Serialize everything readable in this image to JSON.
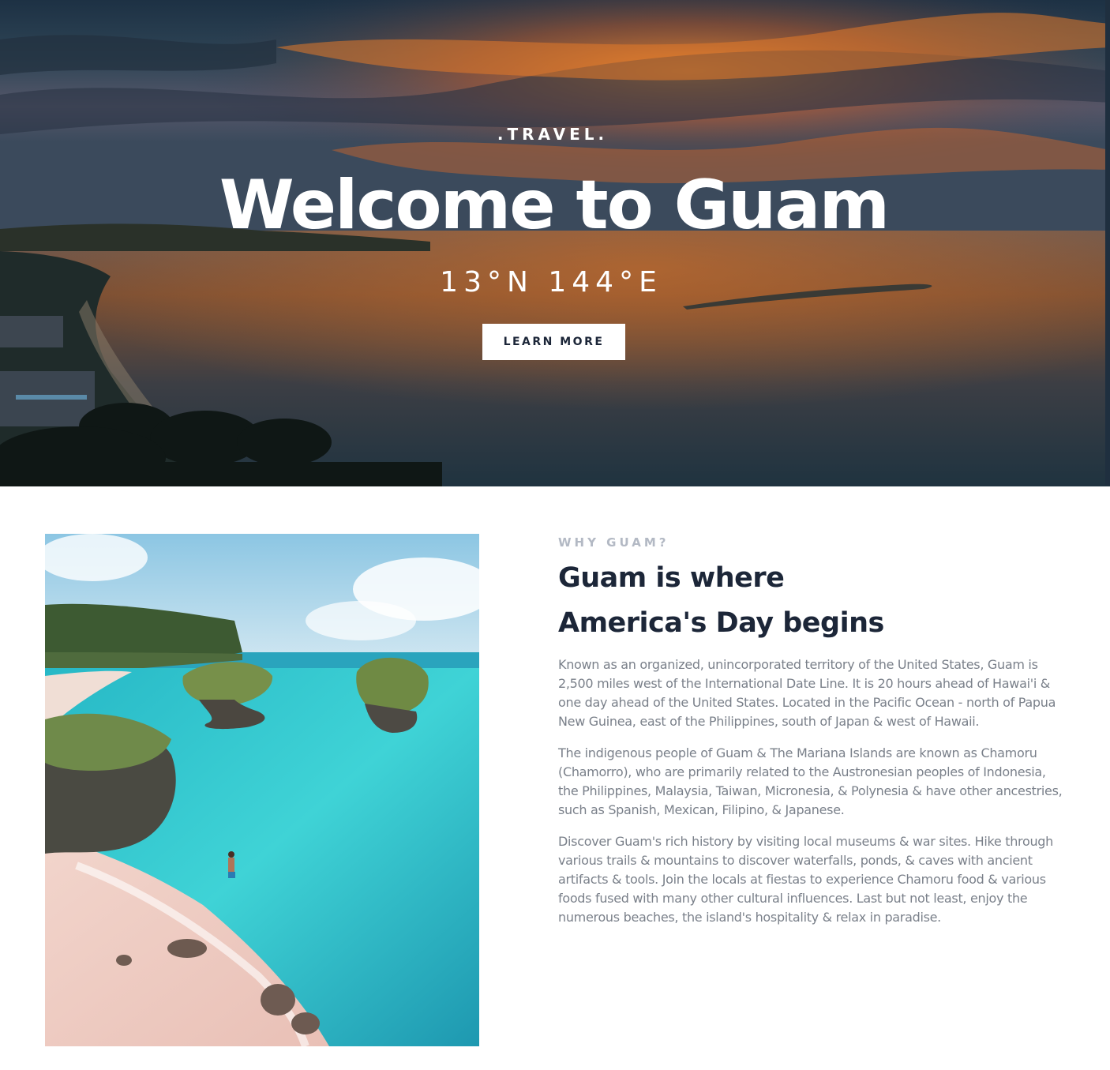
{
  "hero": {
    "eyebrow": ".TRAVEL.",
    "title": "Welcome to Guam",
    "coordinates": "13°N 144°E",
    "button_label": "LEARN MORE"
  },
  "about": {
    "eyebrow": "WHY GUAM?",
    "title_line1": "Guam is where",
    "title_line2": "America's Day begins",
    "paragraphs": [
      "Known as an organized, unincorporated territory of the United States, Guam is 2,500 miles west of the International Date Line. It is 20 hours ahead of Hawai'i & one day ahead of the United States. Located in the Pacific Ocean - north of Papua New Guinea, east of the Philippines, south of Japan & west of Hawaii.",
      "The indigenous people of Guam & The Mariana Islands are known as Chamoru (Chamorro), who are primarily related to the Austronesian peoples of Indonesia, the Philippines, Malaysia, Taiwan, Micronesia, & Polynesia & have other ancestries, such as Spanish, Mexican, Filipino, & Japanese.",
      "Discover Guam's rich history by visiting local museums & war sites. Hike through various trails & mountains to discover waterfalls, ponds, & caves with ancient artifacts & tools. Join the locals at fiestas to experience Chamoru food & various foods fused with many other cultural influences. Last but not least, enjoy the numerous beaches, the island's hospitality & relax in paradise."
    ]
  },
  "colors": {
    "heading": "#1c2638",
    "body_text": "#7a808a",
    "eyebrow_muted": "#b3b9c4",
    "hero_text": "#ffffff"
  }
}
